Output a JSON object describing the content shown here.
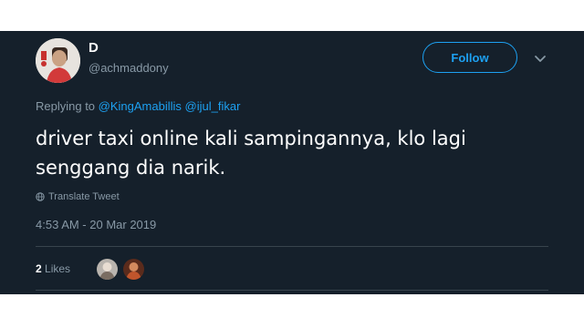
{
  "author": {
    "display_name": "D",
    "handle": "@achmaddony"
  },
  "follow_label": "Follow",
  "reply": {
    "prefix": "Replying to",
    "mentions": [
      "@KingAmabillis",
      "@ijul_fikar"
    ]
  },
  "text_lines": [
    "driver taxi online kali sampingannya, klo lagi",
    "senggang dia narik."
  ],
  "translate_label": "Translate Tweet",
  "timestamp": "4:53 AM - 20 Mar 2019",
  "likes": {
    "count": "2",
    "label": "Likes"
  },
  "colors": {
    "background": "#15202b",
    "accent": "#1da1f2",
    "muted": "#8899a6"
  },
  "icons": [
    "avatar",
    "chevron-down-icon",
    "globe-icon",
    "liker-avatar"
  ]
}
